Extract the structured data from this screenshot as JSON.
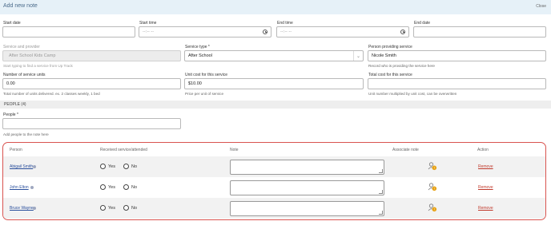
{
  "header": {
    "title": "Add new note",
    "close_label": "Close"
  },
  "form": {
    "start_date": {
      "label": "Start date",
      "value": ""
    },
    "start_time": {
      "label": "Start time",
      "placeholder": "--:-- --"
    },
    "end_time": {
      "label": "End time",
      "placeholder": "--:-- --"
    },
    "end_date": {
      "label": "End date",
      "value": ""
    },
    "service_provider": {
      "label": "Service and provider",
      "value": "After School Kids Camp",
      "help": "Start typing to find a service from Up Track"
    },
    "service_type": {
      "label": "Service type *",
      "value": "After School"
    },
    "person_providing": {
      "label": "Person providing service",
      "value": "Nicole Smith",
      "help": "Record who is providing the service here"
    },
    "units": {
      "label": "Number of service units",
      "value": "0.00",
      "help": "Total number of units delivered. ex. 2 classes weekly, 1 bed"
    },
    "unit_cost": {
      "label": "Unit cost for this service",
      "value": "$10.00",
      "help": "Price per unit of service"
    },
    "total_cost": {
      "label": "Total cost for this service",
      "value": "",
      "help": "Unit number multiplied by unit cost, can be overwritten"
    }
  },
  "people_section": {
    "title": "PEOPLE (4)",
    "field_label": "People *",
    "help": "Add people to the note here"
  },
  "table": {
    "headers": {
      "person": "Person",
      "received": "Received service/attended",
      "note": "Note",
      "associate": "Associate note",
      "action": "Action"
    },
    "yes_label": "Yes",
    "no_label": "No",
    "remove_label": "Remove",
    "rows": [
      {
        "name": "Abigail Smith"
      },
      {
        "name": "John Elton"
      },
      {
        "name": "Bruce Wayne"
      }
    ]
  },
  "colors": {
    "highlight_border": "#d9534f",
    "link": "#2a4f9c",
    "remove": "#c0392b",
    "header_bg": "#e6f1f8"
  }
}
